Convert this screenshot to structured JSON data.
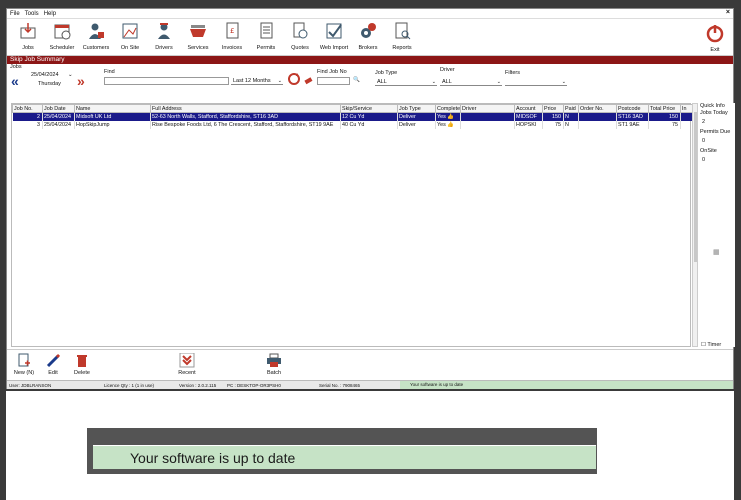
{
  "menu": {
    "file": "File",
    "tools": "Tools",
    "help": "Help"
  },
  "toolbar": {
    "items": [
      "Jobs",
      "Scheduler",
      "Customers",
      "On Site",
      "Drivers",
      "Services",
      "Invoices",
      "Permits",
      "Quotes",
      "Web Import",
      "Brokers",
      "Reports"
    ],
    "exit": "Exit"
  },
  "title": "Skip Job Summary",
  "jobs_label": "Jobs",
  "filter": {
    "date": "25/04/2024",
    "day": "Thursday",
    "find_label": "Find",
    "period": "Last 12 Months",
    "find_job_label": "Find Job No",
    "job_type_label": "Job Type",
    "job_type_value": "ALL",
    "driver_label": "Driver",
    "driver_value": "ALL",
    "filters_label": "Filters"
  },
  "table": {
    "columns": [
      "Job No.",
      "Job Date",
      "Name",
      "Full Address",
      "Skip/Service",
      "Job Type",
      "Complete",
      "Driver",
      "Account",
      "Price",
      "Paid",
      "Order No.",
      "Postcode",
      "Total Price",
      "In"
    ],
    "rows": [
      {
        "job_no": "2",
        "date": "25/04/2024",
        "name": "Midsoft UK Ltd",
        "address": "52-63 North Walls, Stafford, Staffordshire, ST16 3AD",
        "skip": "12 Cu Yd",
        "type": "Deliver",
        "complete": "Yes",
        "driver": "",
        "account": "MIDSOF",
        "price": "150",
        "paid": "N",
        "order": "",
        "postcode": "ST16 3AD",
        "total": "150"
      },
      {
        "job_no": "3",
        "date": "25/04/2024",
        "name": "HopSkipJump",
        "address": "Rise Bespoke Foods Ltd, 6 The Crescent, Stafford, Staffordshire, ST19 9AE",
        "skip": "40 Cu Yd",
        "type": "Deliver",
        "complete": "Yes",
        "driver": "",
        "account": "HOPSKI",
        "price": "75",
        "paid": "N",
        "order": "",
        "postcode": "ST1 9AE",
        "total": "75"
      }
    ]
  },
  "quick_info": {
    "title": "Quick Info",
    "jobs_today_label": "Jobs Today",
    "jobs_today": "2",
    "permits_due_label": "Permits Due",
    "permits_due": "0",
    "onsite_label": "OnSite",
    "onsite": "0",
    "timer_label": "Timer"
  },
  "bottom_toolbar": {
    "new": "New (N)",
    "edit": "Edit",
    "delete": "Delete",
    "recent": "Recent",
    "batch": "Batch"
  },
  "status": {
    "user": "User: JDBLRANSON",
    "licence": "Licence Qty : 1 (1 in use)",
    "version": "Version : 2.0.2.115",
    "pc": "PC : DESKTOP-OR3PSH0",
    "serial": "Serial No. : 7908465",
    "message": "Your software is up to date"
  },
  "zoom_message": "Your software is up to date",
  "colors": {
    "title_bar": "#8c1616",
    "accent_red": "#c0392b",
    "selected_row": "#1a1a8a",
    "status_green": "#c6e3c6"
  }
}
